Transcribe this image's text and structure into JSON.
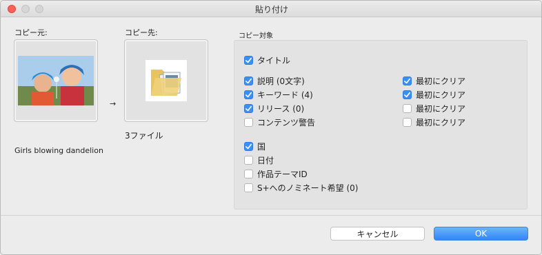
{
  "window": {
    "title": "貼り付け"
  },
  "source": {
    "label": "コピー元:",
    "caption": "Girls blowing dandelion"
  },
  "destination": {
    "label": "コピー先:",
    "caption": "3ファイル"
  },
  "arrow": "→",
  "copy_targets": {
    "label": "コピー対象",
    "title_option": {
      "label": "タイトル",
      "checked": true
    },
    "left_options": [
      {
        "label": "説明 (0文字)",
        "checked": true
      },
      {
        "label": "キーワード (4)",
        "checked": true
      },
      {
        "label": "リリース (0)",
        "checked": true
      },
      {
        "label": "コンテンツ警告",
        "checked": false
      }
    ],
    "right_options": [
      {
        "label": "最初にクリア",
        "checked": true
      },
      {
        "label": "最初にクリア",
        "checked": true
      },
      {
        "label": "最初にクリア",
        "checked": false
      },
      {
        "label": "最初にクリア",
        "checked": false
      }
    ],
    "lower_options": [
      {
        "label": "国",
        "checked": true
      },
      {
        "label": "日付",
        "checked": false
      },
      {
        "label": "作品テーマID",
        "checked": false
      },
      {
        "label": "S+へのノミネート希望 (0)",
        "checked": false
      }
    ]
  },
  "buttons": {
    "cancel": "キャンセル",
    "ok": "OK"
  },
  "colors": {
    "accent": "#3a8ff7",
    "close": "#fc5f57"
  }
}
